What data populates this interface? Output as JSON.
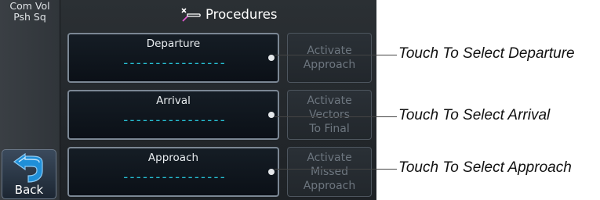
{
  "left_panel": {
    "com_vol_line1": "Com Vol",
    "com_vol_line2": "Psh Sq",
    "back_label": "Back"
  },
  "header": {
    "title": "Procedures",
    "icon": "procedures-icon"
  },
  "procedures": [
    {
      "label": "Departure",
      "value": "----------------"
    },
    {
      "label": "Arrival",
      "value": "----------------"
    },
    {
      "label": "Approach",
      "value": "----------------"
    }
  ],
  "activate_buttons": [
    {
      "lines": [
        "Activate",
        "Approach"
      ]
    },
    {
      "lines": [
        "Activate",
        "Vectors",
        "To Final"
      ]
    },
    {
      "lines": [
        "Activate",
        "Missed",
        "Approach"
      ]
    }
  ],
  "annotations": [
    "Touch To Select Departure",
    "Touch To Select Arrival",
    "Touch To Select Approach"
  ],
  "colors": {
    "dash_value": "#27c3d6",
    "disabled_text": "#6d767f"
  }
}
